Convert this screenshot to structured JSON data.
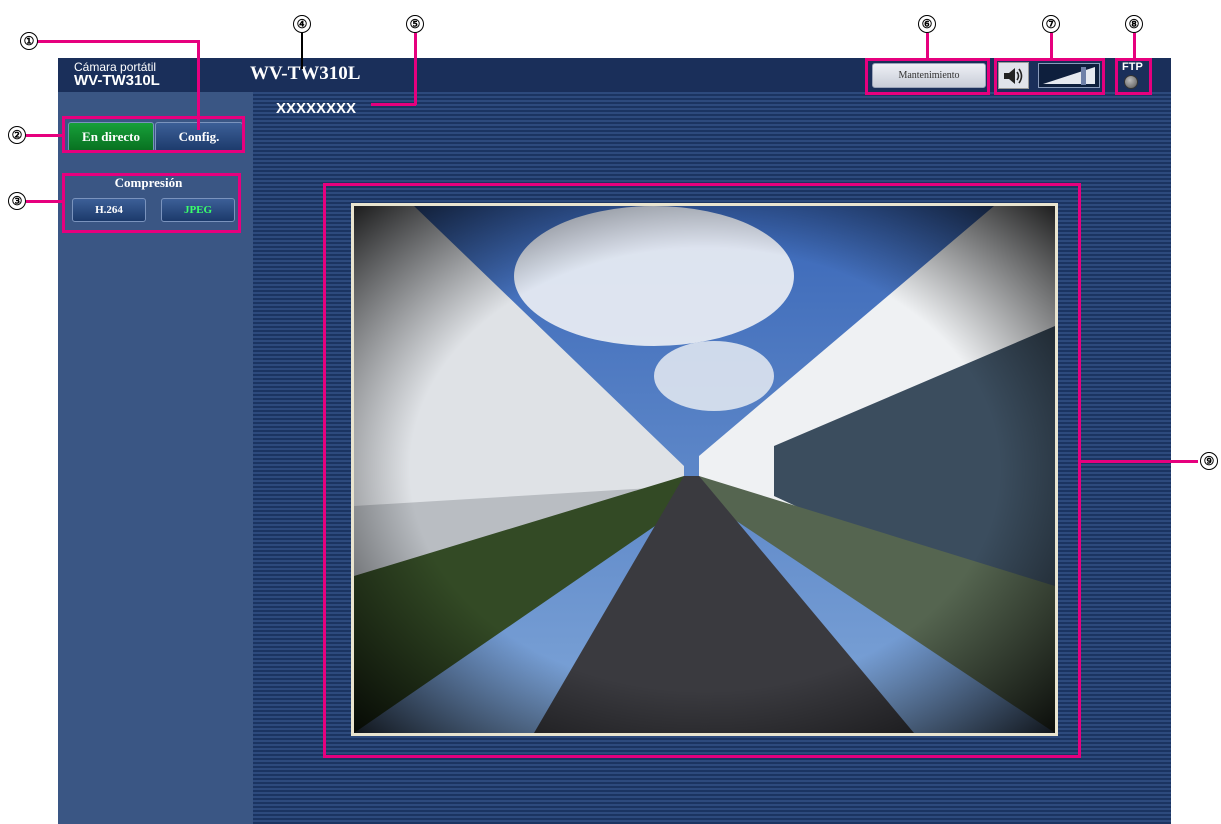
{
  "header": {
    "device_type": "Cámara portátil",
    "device_model": "WV-TW310L",
    "camera_title": "WV-TW310L",
    "maintenance_label": "Mantenimiento",
    "ftp_label": "FTP"
  },
  "nav": {
    "live_label": "En directo",
    "config_label": "Config."
  },
  "compression": {
    "title": "Compresión",
    "h264_label": "H.264",
    "jpeg_label": "JPEG",
    "selected": "JPEG"
  },
  "camera_name": "XXXXXXXX",
  "callouts": [
    "①",
    "②",
    "③",
    "④",
    "⑤",
    "⑥",
    "⑦",
    "⑧",
    "⑨"
  ],
  "icons": {
    "speaker": "speaker-icon",
    "volume": "volume-bar-icon",
    "ftp_status": "ftp-status-indicator"
  },
  "colors": {
    "highlight": "#e6007e",
    "live_button": "#118a2f",
    "jpeg_text": "#39ff6a"
  }
}
